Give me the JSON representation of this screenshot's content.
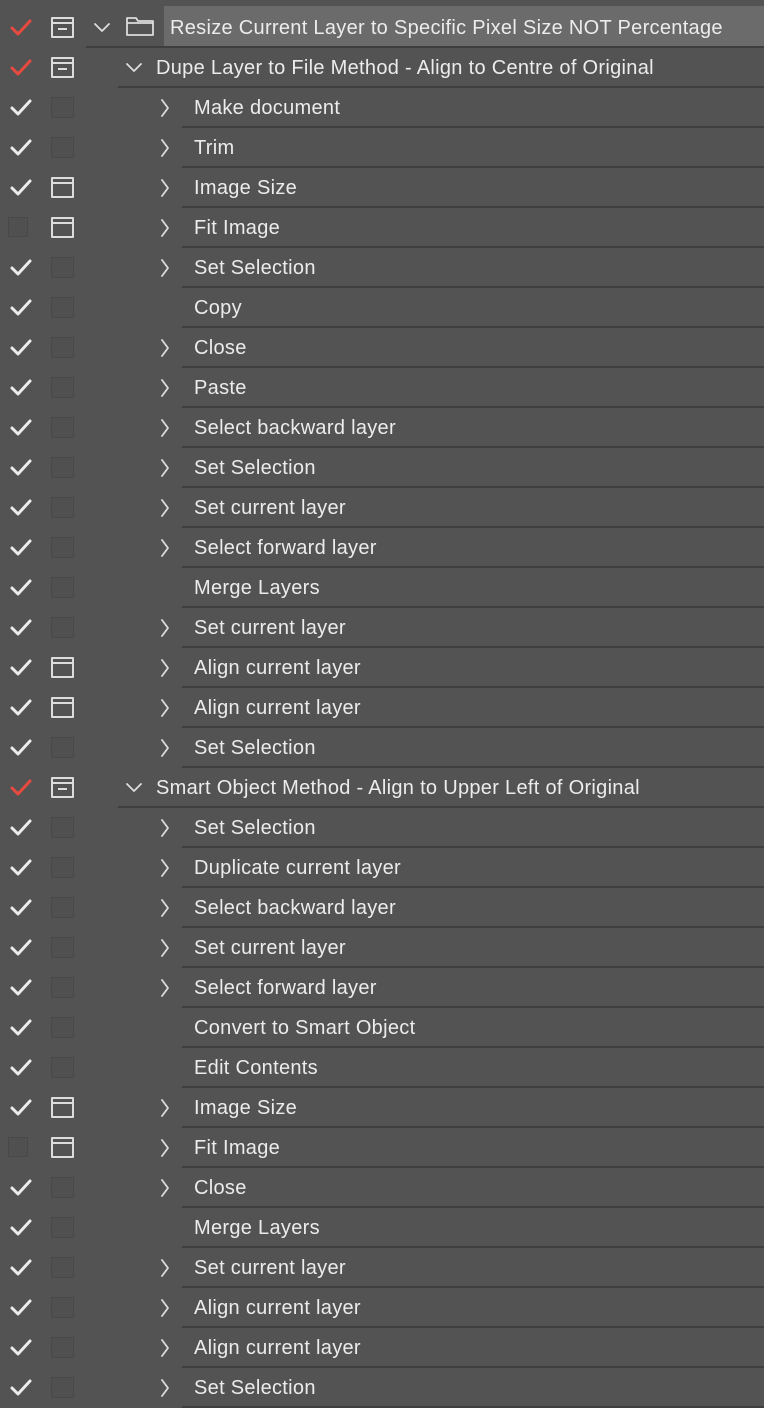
{
  "colors": {
    "panel_bg": "#535353",
    "separator": "#3e3e3e",
    "check_white": "#ececec",
    "check_red": "#e84a3f",
    "selected_row": "#6b6b6b"
  },
  "icons": {
    "check": "check-icon",
    "dialog_toggle": "dialog-toggle-icon",
    "expand_open": "chevron-down-icon",
    "expand_closed": "chevron-right-icon",
    "set": "folder-icon"
  },
  "rows": [
    {
      "level": 0,
      "label": "Resize Current Layer to Specific Pixel Size NOT Percentage",
      "check": "red",
      "dialog": "partial",
      "expander": "open"
    },
    {
      "level": 1,
      "label": "Dupe Layer to File Method - Align to Centre of Original",
      "check": "red",
      "dialog": "partial",
      "expander": "open"
    },
    {
      "level": 2,
      "label": "Make document",
      "check": "white",
      "dialog": "empty",
      "expander": "closed"
    },
    {
      "level": 2,
      "label": "Trim",
      "check": "white",
      "dialog": "empty",
      "expander": "closed"
    },
    {
      "level": 2,
      "label": "Image Size",
      "check": "white",
      "dialog": "on",
      "expander": "closed"
    },
    {
      "level": 2,
      "label": "Fit Image",
      "check": "none",
      "dialog": "on",
      "expander": "closed"
    },
    {
      "level": 2,
      "label": "Set Selection",
      "check": "white",
      "dialog": "empty",
      "expander": "closed"
    },
    {
      "level": 2,
      "label": "Copy",
      "check": "white",
      "dialog": "empty",
      "expander": "none"
    },
    {
      "level": 2,
      "label": "Close",
      "check": "white",
      "dialog": "empty",
      "expander": "closed"
    },
    {
      "level": 2,
      "label": "Paste",
      "check": "white",
      "dialog": "empty",
      "expander": "closed"
    },
    {
      "level": 2,
      "label": "Select backward layer",
      "check": "white",
      "dialog": "empty",
      "expander": "closed"
    },
    {
      "level": 2,
      "label": "Set Selection",
      "check": "white",
      "dialog": "empty",
      "expander": "closed"
    },
    {
      "level": 2,
      "label": "Set current layer",
      "check": "white",
      "dialog": "empty",
      "expander": "closed"
    },
    {
      "level": 2,
      "label": "Select forward layer",
      "check": "white",
      "dialog": "empty",
      "expander": "closed"
    },
    {
      "level": 2,
      "label": "Merge Layers",
      "check": "white",
      "dialog": "empty",
      "expander": "none"
    },
    {
      "level": 2,
      "label": "Set current layer",
      "check": "white",
      "dialog": "empty",
      "expander": "closed"
    },
    {
      "level": 2,
      "label": "Align current layer",
      "check": "white",
      "dialog": "on",
      "expander": "closed"
    },
    {
      "level": 2,
      "label": "Align current layer",
      "check": "white",
      "dialog": "on",
      "expander": "closed"
    },
    {
      "level": 2,
      "label": "Set Selection",
      "check": "white",
      "dialog": "empty",
      "expander": "closed"
    },
    {
      "level": 1,
      "label": "Smart Object Method - Align to Upper Left of Original",
      "check": "red",
      "dialog": "partial",
      "expander": "open"
    },
    {
      "level": 2,
      "label": "Set Selection",
      "check": "white",
      "dialog": "empty",
      "expander": "closed"
    },
    {
      "level": 2,
      "label": "Duplicate current layer",
      "check": "white",
      "dialog": "empty",
      "expander": "closed"
    },
    {
      "level": 2,
      "label": "Select backward layer",
      "check": "white",
      "dialog": "empty",
      "expander": "closed"
    },
    {
      "level": 2,
      "label": "Set current layer",
      "check": "white",
      "dialog": "empty",
      "expander": "closed"
    },
    {
      "level": 2,
      "label": "Select forward layer",
      "check": "white",
      "dialog": "empty",
      "expander": "closed"
    },
    {
      "level": 2,
      "label": "Convert to Smart Object",
      "check": "white",
      "dialog": "empty",
      "expander": "none"
    },
    {
      "level": 2,
      "label": "Edit Contents",
      "check": "white",
      "dialog": "empty",
      "expander": "none"
    },
    {
      "level": 2,
      "label": "Image Size",
      "check": "white",
      "dialog": "on",
      "expander": "closed"
    },
    {
      "level": 2,
      "label": "Fit Image",
      "check": "none",
      "dialog": "on",
      "expander": "closed"
    },
    {
      "level": 2,
      "label": "Close",
      "check": "white",
      "dialog": "empty",
      "expander": "closed"
    },
    {
      "level": 2,
      "label": "Merge Layers",
      "check": "white",
      "dialog": "empty",
      "expander": "none"
    },
    {
      "level": 2,
      "label": "Set current layer",
      "check": "white",
      "dialog": "empty",
      "expander": "closed"
    },
    {
      "level": 2,
      "label": "Align current layer",
      "check": "white",
      "dialog": "empty",
      "expander": "closed"
    },
    {
      "level": 2,
      "label": "Align current layer",
      "check": "white",
      "dialog": "empty",
      "expander": "closed"
    },
    {
      "level": 2,
      "label": "Set Selection",
      "check": "white",
      "dialog": "empty",
      "expander": "closed"
    }
  ]
}
